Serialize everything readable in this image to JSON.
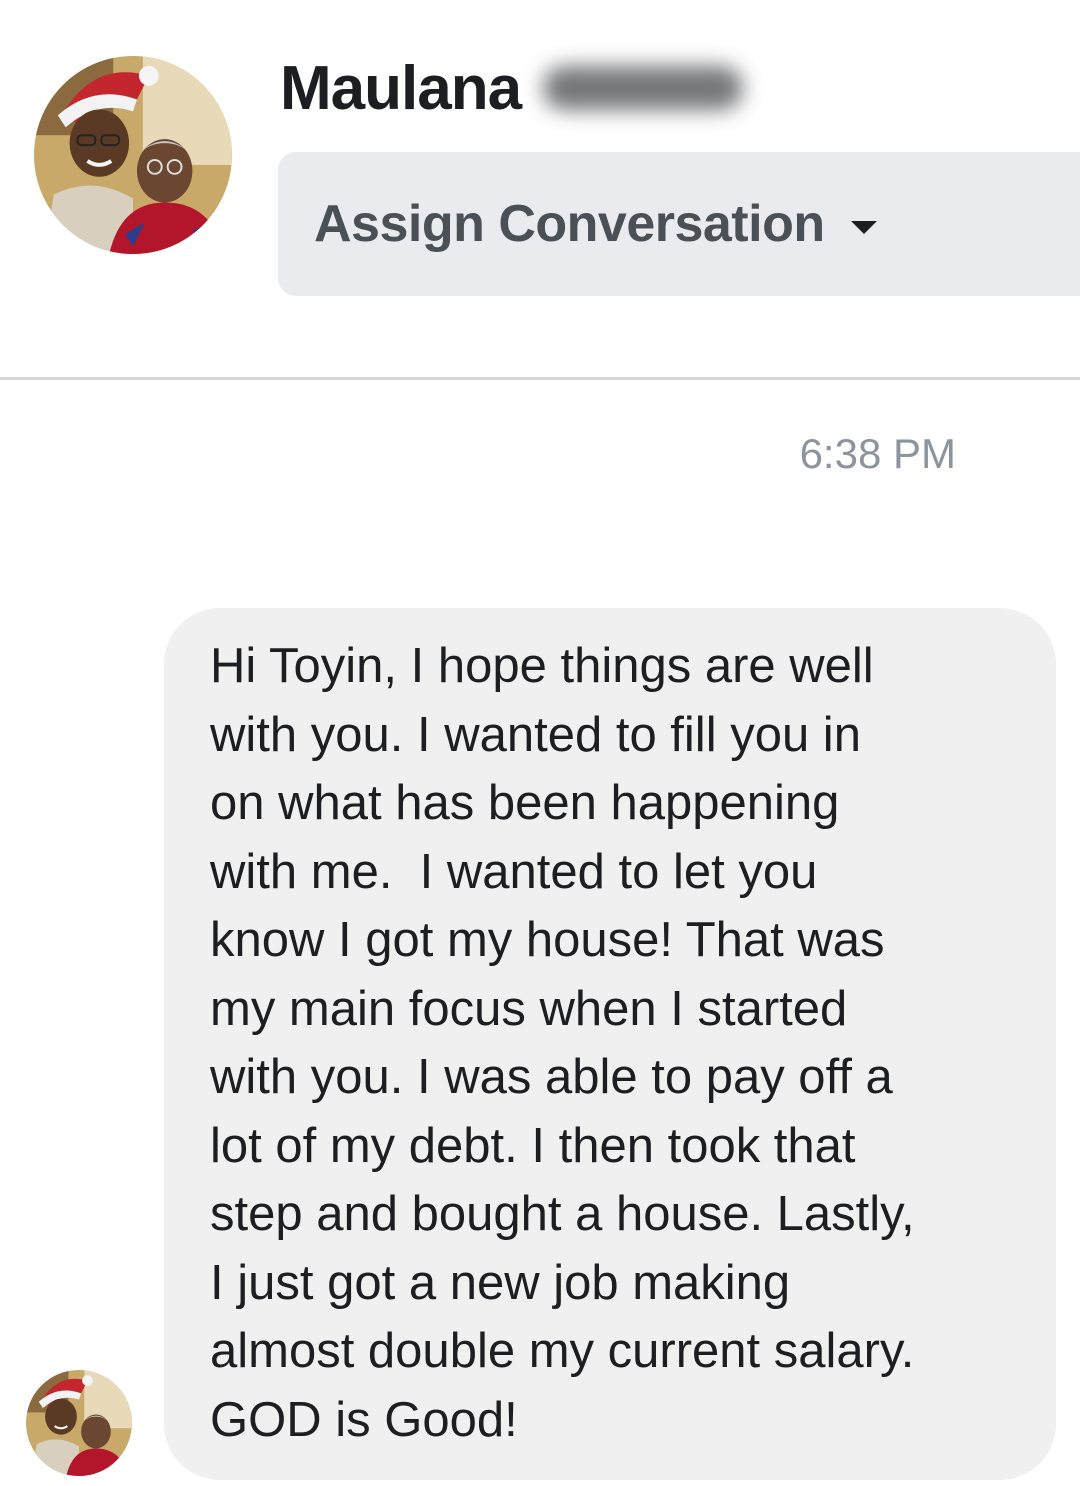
{
  "header": {
    "contact_first_name": "Maulana",
    "assign_button_label": "Assign Conversation"
  },
  "icons": {
    "avatar": "profile-photo",
    "assign_dropdown": "caret-down-icon"
  },
  "thread": {
    "timestamp": "6:38 PM",
    "messages": [
      {
        "text": "Hi Toyin, I hope things are well\nwith you. I wanted to fill you in\non what has been happening\nwith me.  I wanted to let you\nknow I got my house! That was\nmy main focus when I started\nwith you. I was able to pay off a\nlot of my debt. I then took that\nstep and bought a house. Lastly,\nI just got a new job making\nalmost double my current salary.\nGOD is Good!"
      }
    ]
  },
  "colors": {
    "bubble_background": "#f1f0f0",
    "assign_button_background": "#e9ebee",
    "timestamp_text": "#8d949e",
    "divider": "#d5d7db"
  }
}
